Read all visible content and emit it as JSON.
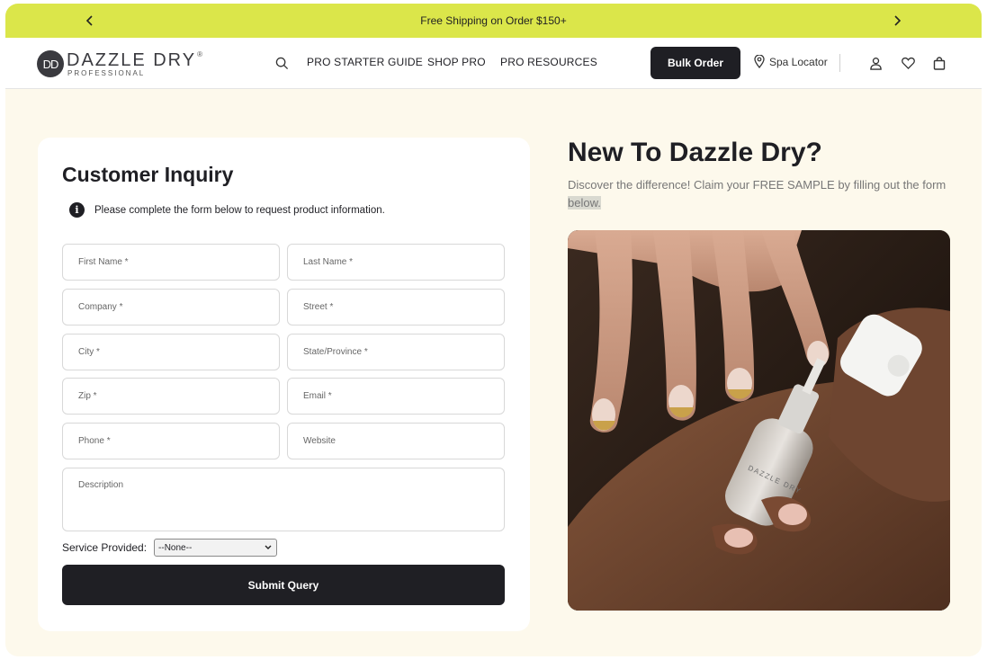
{
  "promo": {
    "text": "Free Shipping on Order $150+",
    "prev_icon": "chevron-left-icon",
    "next_icon": "chevron-right-icon"
  },
  "header": {
    "logo": {
      "badge": "DD",
      "word": "DAZZLE DRY",
      "registered": "®",
      "sub": "PROFESSIONAL"
    },
    "nav": [
      "PRO STARTER GUIDE",
      "SHOP PRO",
      "PRO RESOURCES"
    ],
    "bulk_order": "Bulk Order",
    "spa_locator": "Spa Locator",
    "icons": [
      "search-icon",
      "map-pin-icon",
      "account-icon",
      "heart-icon",
      "bag-icon"
    ]
  },
  "form": {
    "title": "Customer Inquiry",
    "info": "Please complete the form below to request product information.",
    "fields": {
      "first_name": "First Name *",
      "last_name": "Last Name *",
      "company": "Company *",
      "street": "Street *",
      "city": "City *",
      "state": "State/Province *",
      "zip": "Zip *",
      "email": "Email *",
      "phone": "Phone *",
      "website": "Website",
      "description": "Description"
    },
    "service_label": "Service Provided:",
    "service_value": "--None--",
    "submit": "Submit Query"
  },
  "promo_panel": {
    "title": "New To Dazzle Dry?",
    "text": "Discover the difference! Claim your FREE SAMPLE by filling out the form",
    "text_highlight": "below.",
    "bottle_label": "DAZZLE DRY"
  },
  "colors": {
    "promo_bar": "#dbe64a",
    "dark": "#1f1f24",
    "page_bg": "#fdf9ec"
  }
}
